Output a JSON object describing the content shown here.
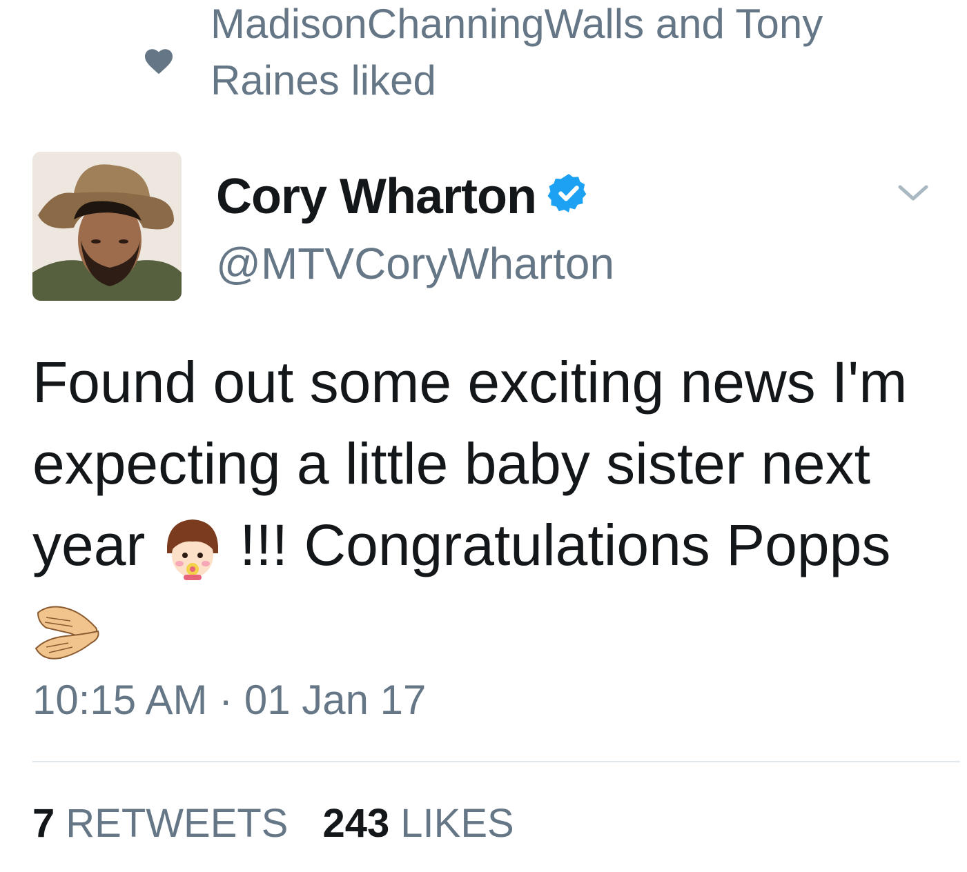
{
  "social_context": {
    "text": "MadisonChanningWalls and Tony Raines liked",
    "icon": "heart-icon"
  },
  "tweet": {
    "display_name": "Cory Wharton",
    "handle": "@MTVCoryWharton",
    "verified": true,
    "text_part1": "Found out some exciting news I'm expecting a little baby sister next year ",
    "text_part2": " !!! Congratulations Popps ",
    "timestamp": "10:15 AM · 01 Jan 17",
    "retweets_count": "7",
    "retweets_label": "RETWEETS",
    "likes_count": "243",
    "likes_label": "LIKES"
  },
  "icons": {
    "verified": "verified-badge-icon",
    "menu": "chevron-down-icon",
    "emoji_1": "baby-emoji-icon",
    "emoji_2": "clapping-hands-emoji-icon"
  },
  "colors": {
    "text_primary": "#14171a",
    "text_secondary": "#657786",
    "verified_blue": "#1da1f2",
    "divider": "#e1e8ed"
  }
}
